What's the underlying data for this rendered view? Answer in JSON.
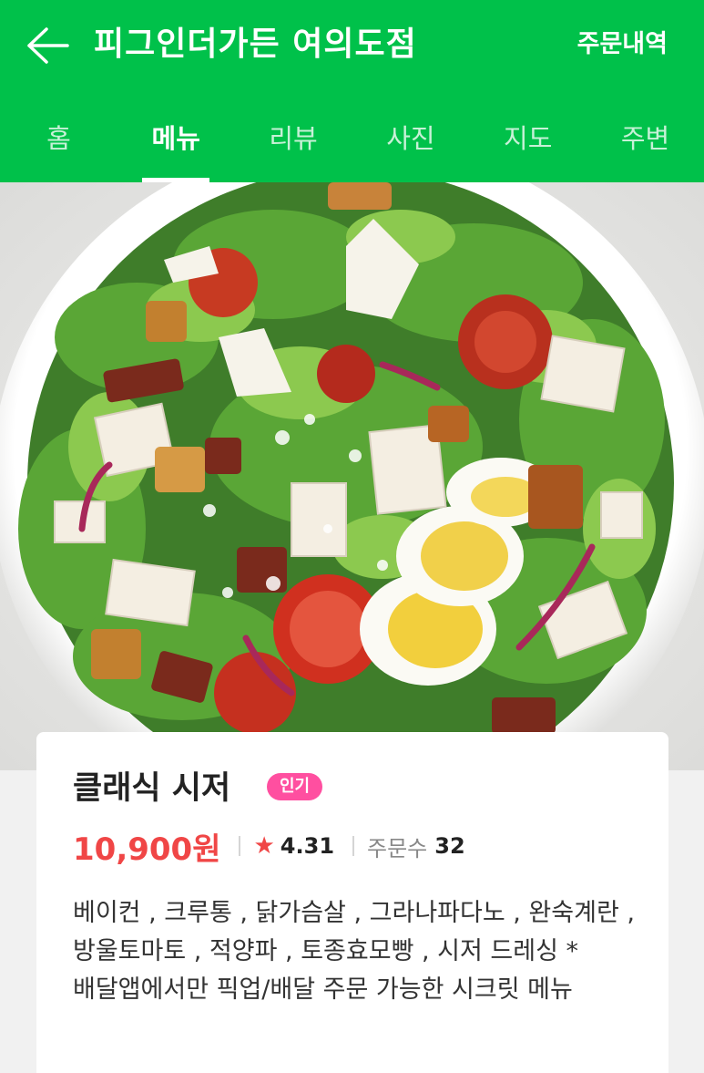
{
  "header": {
    "back_icon": "arrow-left-icon",
    "title": "피그인더가든 여의도점",
    "order_history": "주문내역"
  },
  "tabs": [
    {
      "label": "홈",
      "active": false
    },
    {
      "label": "메뉴",
      "active": true
    },
    {
      "label": "리뷰",
      "active": false
    },
    {
      "label": "사진",
      "active": false
    },
    {
      "label": "지도",
      "active": false
    },
    {
      "label": "주변",
      "active": false
    }
  ],
  "menu_item": {
    "name": "클래식 시저",
    "badge": "인기",
    "price": "10,900원",
    "rating_icon": "star-icon",
    "star_glyph": "★",
    "rating": "4.31",
    "order_count_label": "주문수",
    "order_count": "32",
    "description": "베이컨 , 크루통 , 닭가슴살 , 그라나파다노 , 완숙계란 , 방울토마토 , 적양파 , 토종효모빵 , 시저 드레싱 *배달앱에서만 픽업/배달 주문 가능한 시크릿 메뉴"
  },
  "colors": {
    "brand": "#00c14a",
    "price": "#f04646",
    "badge": "#ff4fa0"
  }
}
